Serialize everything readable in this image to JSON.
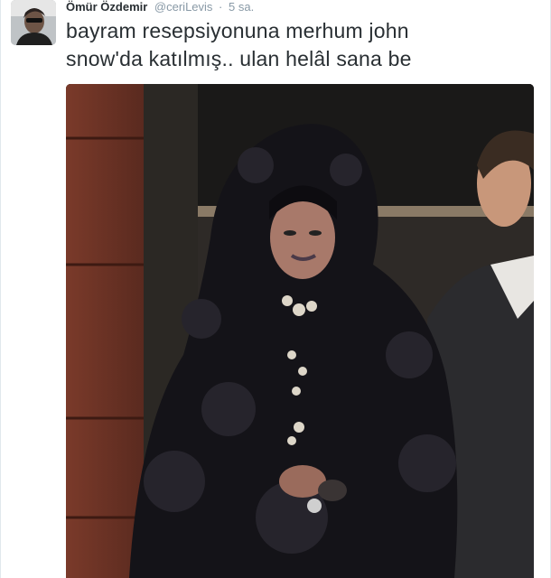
{
  "tweet": {
    "author_name": "Ömür Özdemir",
    "author_handle": "@ceriLevis",
    "separator": "·",
    "timestamp": "5 sa.",
    "text_lines": [
      "bayram resepsiyonuna merhum john",
      "snow'da katılmış.. ulan helâl sana be"
    ],
    "avatar_icon": "user-avatar",
    "media_icon": "photo-media"
  }
}
